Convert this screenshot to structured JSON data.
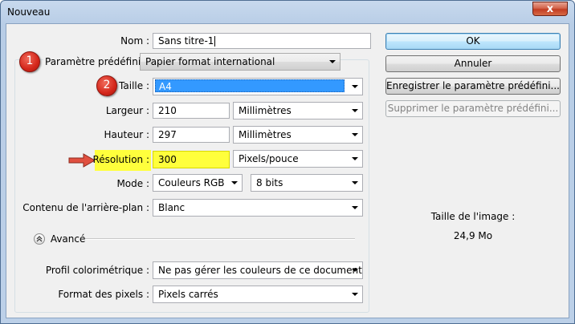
{
  "window": {
    "title": "Nouveau",
    "close": "x"
  },
  "form": {
    "nom": {
      "label": "Nom :",
      "value": "Sans titre-1"
    },
    "preset": {
      "label": "Paramètre prédéfini :",
      "value": "Papier format international"
    },
    "taille": {
      "label": "Taille :",
      "value": "A4"
    },
    "largeur": {
      "label": "Largeur :",
      "value": "210",
      "unit": "Millimètres"
    },
    "hauteur": {
      "label": "Hauteur :",
      "value": "297",
      "unit": "Millimètres"
    },
    "resolution": {
      "label": "Résolution :",
      "value": "300",
      "unit": "Pixels/pouce"
    },
    "mode": {
      "label": "Mode :",
      "value": "Couleurs RGB",
      "depth": "8 bits"
    },
    "contenu": {
      "label": "Contenu de l'arrière-plan :",
      "value": "Blanc"
    },
    "avance": {
      "label": "Avancé",
      "icon": "chevron-up-icon"
    },
    "profil": {
      "label": "Profil colorimétrique :",
      "value": "Ne pas gérer les couleurs de ce document"
    },
    "format_pixels": {
      "label": "Format des pixels :",
      "value": "Pixels carrés"
    }
  },
  "buttons": {
    "ok": "OK",
    "cancel": "Annuler",
    "save_preset": "Enregistrer le paramètre prédéfini...",
    "delete_preset": "Supprimer le paramètre prédéfini..."
  },
  "image_size": {
    "label": "Taille de l'image :",
    "value": "24,9 Mo"
  },
  "annotations": {
    "badge1": "1",
    "badge2": "2"
  },
  "colors": {
    "highlight": "#ffff3c",
    "selection": "#3399ff",
    "badge": "#d4261a",
    "arrow": "#e05040"
  }
}
